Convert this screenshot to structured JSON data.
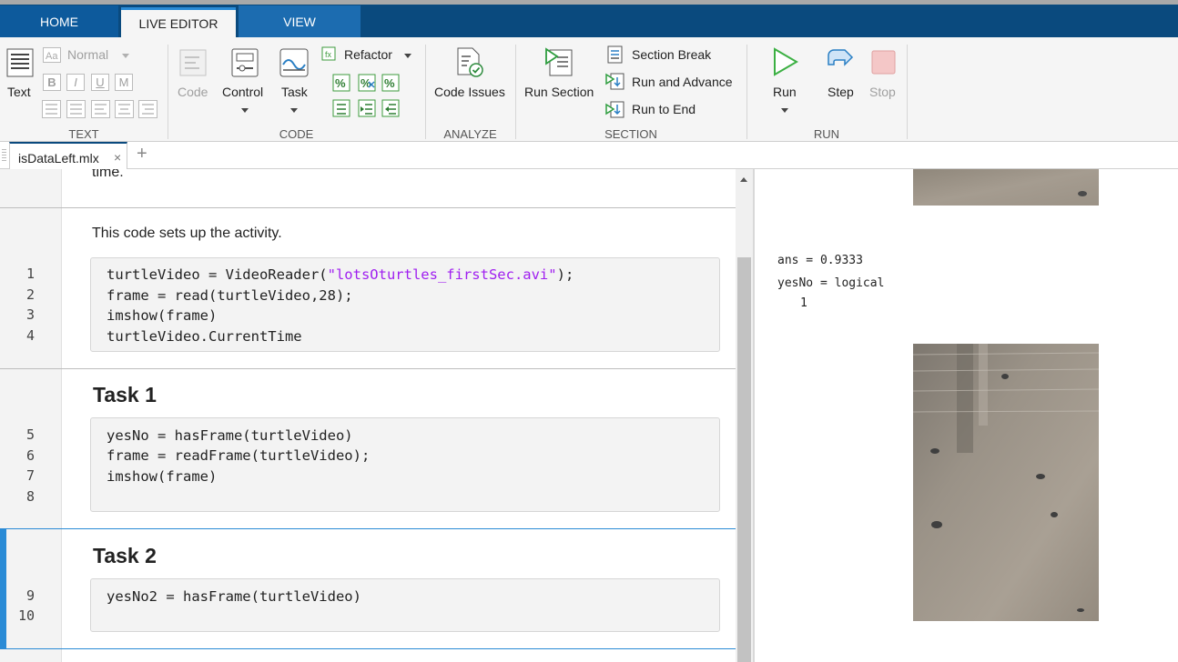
{
  "tabs": [
    "HOME",
    "LIVE EDITOR",
    "VIEW"
  ],
  "ribbon": {
    "text_group": {
      "text_button": "Text",
      "style_select": "Normal",
      "format_buttons": [
        "B",
        "I",
        "U",
        "M"
      ],
      "label": "TEXT"
    },
    "code_group": {
      "code_button": "Code",
      "control_button": "Control",
      "task_button": "Task",
      "refactor_button": "Refactor",
      "label": "CODE"
    },
    "analyze_group": {
      "code_issues_button": "Code Issues",
      "label": "ANALYZE"
    },
    "section_group": {
      "run_section_button": "Run Section",
      "section_break_button": "Section Break",
      "run_and_advance_button": "Run and Advance",
      "run_to_end_button": "Run to End",
      "label": "SECTION"
    },
    "run_group": {
      "run_button": "Run",
      "step_button": "Step",
      "stop_button": "Stop",
      "label": "RUN"
    }
  },
  "file_tab": {
    "name": "isDataLeft.mlx",
    "close": "×",
    "add": "+"
  },
  "editor": {
    "top_text": "time.",
    "intro_text": "This code sets up the activity.",
    "code1": {
      "line_numbers": [
        "1",
        "2",
        "3",
        "4"
      ],
      "line1_pre": "turtleVideo = VideoReader(",
      "line1_str": "\"lotsOturtles_firstSec.avi\"",
      "line1_post": ");",
      "line2": "frame = read(turtleVideo,28);",
      "line3": "imshow(frame)",
      "line4": "turtleVideo.CurrentTime"
    },
    "task1": {
      "heading": "Task 1",
      "line_numbers": [
        "5",
        "6",
        "7",
        "8"
      ],
      "lines": [
        "yesNo = hasFrame(turtleVideo)",
        "frame = readFrame(turtleVideo);",
        "imshow(frame)"
      ]
    },
    "task2": {
      "heading": "Task 2",
      "line_numbers": [
        "9",
        "10"
      ],
      "lines": [
        "yesNo2 = hasFrame(turtleVideo)"
      ]
    }
  },
  "output": {
    "ans": "ans = 0.9333",
    "yesno": "yesNo = logical",
    "yesno_value": "1"
  },
  "colors": {
    "tab_bar": "#0a4a7e",
    "accent": "#2a8bd6",
    "string": "#a020f0",
    "run_green": "#3cb043",
    "stop_red": "#f4c7c7"
  }
}
